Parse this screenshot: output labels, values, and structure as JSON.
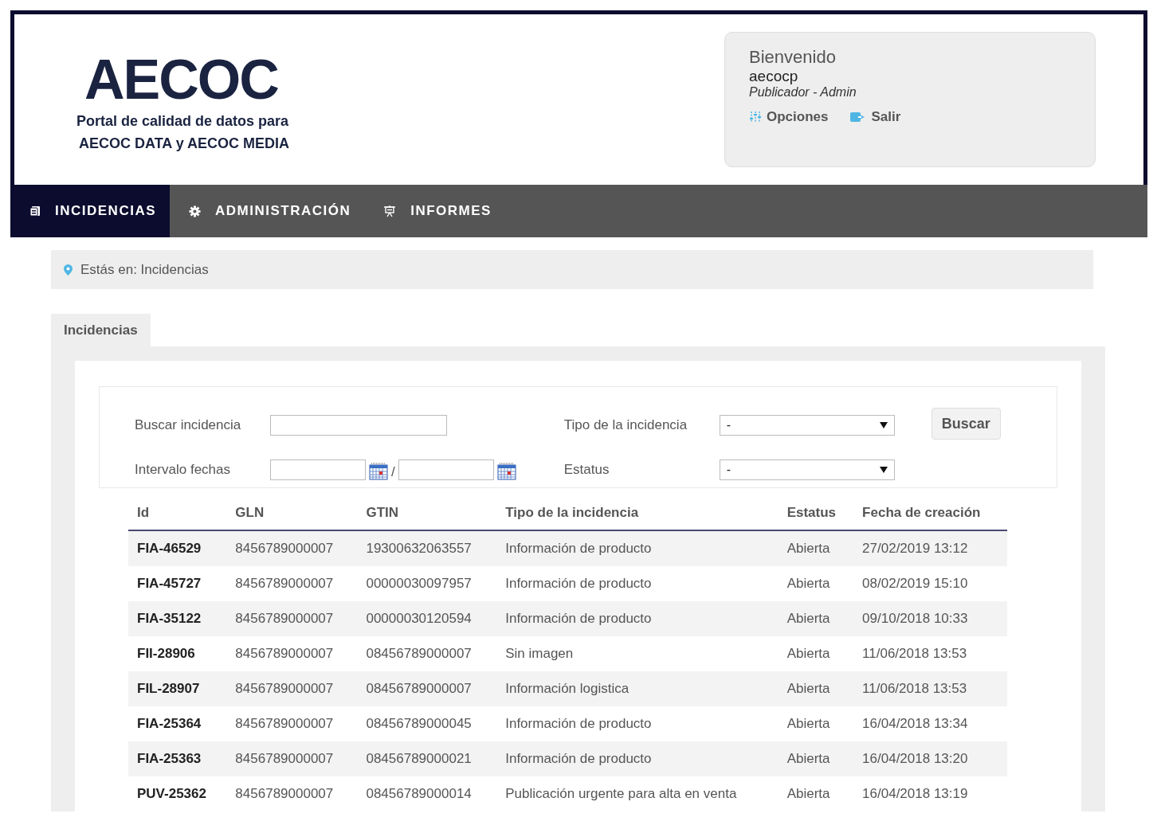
{
  "header": {
    "logo": "AECOC",
    "tagline_lines": [
      "Portal de calidad de datos para",
      "AECOC DATA y AECOC MEDIA"
    ]
  },
  "user_panel": {
    "greeting": "Bienvenido",
    "username": "aecocp",
    "role": "Publicador - Admin",
    "links": [
      {
        "kind": "options",
        "label": "Opciones"
      },
      {
        "kind": "logout",
        "label": "Salir"
      }
    ]
  },
  "nav": [
    {
      "kind": "incidents",
      "label": "INCIDENCIAS",
      "selected": true
    },
    {
      "kind": "admin",
      "label": "ADMINISTRACIÓN",
      "selected": false
    },
    {
      "kind": "reports",
      "label": "INFORMES",
      "selected": false
    }
  ],
  "breadcrumb": "Estás en: Incidencias",
  "tabs": [
    {
      "label": "Incidencias",
      "selected": true
    }
  ],
  "filters": {
    "search_label": "Buscar incidencia",
    "date_label": "Intervalo fechas",
    "date_separator": "/",
    "type_label": "Tipo de la incidencia",
    "type_value": "-",
    "status_label": "Estatus",
    "status_value": "-",
    "button": "Buscar"
  },
  "table": {
    "columns": [
      "Id",
      "GLN",
      "GTIN",
      "Tipo de la incidencia",
      "Estatus",
      "Fecha de creación"
    ],
    "rows": [
      [
        "FIA-46529",
        "8456789000007",
        "19300632063557",
        "Información de producto",
        "Abierta",
        "27/02/2019 13:12"
      ],
      [
        "FIA-45727",
        "8456789000007",
        "00000030097957",
        "Información de producto",
        "Abierta",
        "08/02/2019 15:10"
      ],
      [
        "FIA-35122",
        "8456789000007",
        "00000030120594",
        "Información de producto",
        "Abierta",
        "09/10/2018 10:33"
      ],
      [
        "FII-28906",
        "8456789000007",
        "08456789000007",
        "Sin imagen",
        "Abierta",
        "11/06/2018 13:53"
      ],
      [
        "FIL-28907",
        "8456789000007",
        "08456789000007",
        "Información logistica",
        "Abierta",
        "11/06/2018 13:53"
      ],
      [
        "FIA-25364",
        "8456789000007",
        "08456789000045",
        "Información de producto",
        "Abierta",
        "16/04/2018 13:34"
      ],
      [
        "FIA-25363",
        "8456789000007",
        "08456789000021",
        "Información de producto",
        "Abierta",
        "16/04/2018 13:20"
      ],
      [
        "PUV-25362",
        "8456789000007",
        "08456789000014",
        "Publicación urgente para alta en venta",
        "Abierta",
        "16/04/2018 13:19"
      ]
    ]
  }
}
